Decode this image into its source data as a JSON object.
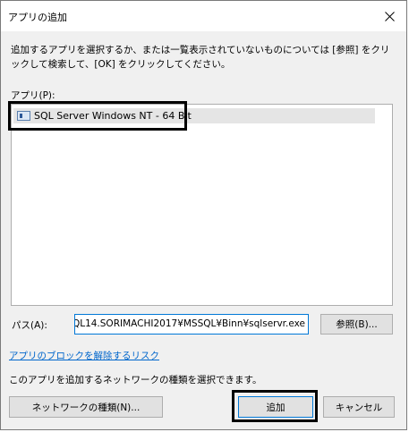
{
  "window": {
    "title": "アプリの追加",
    "close_icon": "close-icon"
  },
  "description": "追加するアプリを選択するか、または一覧表示されていないものについては [参照] をクリックして検索して、[OK] をクリックしてください。",
  "apps": {
    "label": "アプリ(P):",
    "items": [
      {
        "label": "SQL Server Windows NT - 64 Bit",
        "icon": "app-window-icon"
      }
    ]
  },
  "path": {
    "label": "パス(A):",
    "value": "QL14.SORIMACHI2017¥MSSQL¥Binn¥sqlservr.exe"
  },
  "buttons": {
    "browse": "参照(B)...",
    "network_type": "ネットワークの種類(N)...",
    "add": "追加",
    "cancel": "キャンセル"
  },
  "link": "アプリのブロックを解除するリスク",
  "network_description": "このアプリを追加するネットワークの種類を選択できます。",
  "colors": {
    "dialog_bg": "#f0f0f0",
    "link": "#0066cc",
    "focus_border": "#0078d7",
    "selected_item": "#e5e5e5"
  }
}
